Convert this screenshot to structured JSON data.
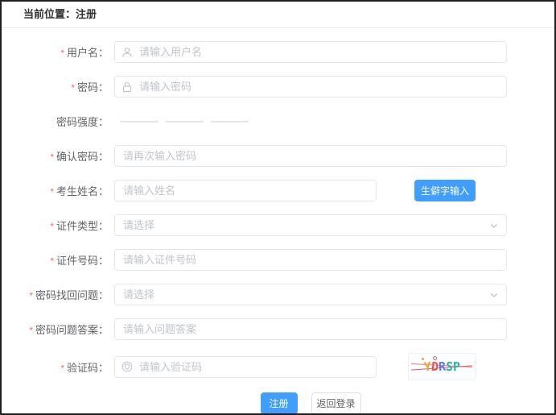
{
  "colors": {
    "primary": "#409eff",
    "required_asterisk": "#f56c6c",
    "label_text": "#606266",
    "placeholder_text": "#c0c4cc",
    "input_border": "#e4e7ed",
    "strength_bar": "#e2e5f0"
  },
  "required_mark": "*",
  "header": {
    "breadcrumb": "当前位置：注册"
  },
  "form": {
    "username": {
      "label": "用户名：",
      "placeholder": "请输入用户名"
    },
    "password": {
      "label": "密码：",
      "placeholder": "请输入密码"
    },
    "strength": {
      "label": "密码强度：",
      "bars": 3
    },
    "confirm_password": {
      "label": "确认密码：",
      "placeholder": "请再次输入密码"
    },
    "candidate_name": {
      "label": "考生姓名：",
      "placeholder": "请输入姓名",
      "rare_char_button": "生僻字输入"
    },
    "id_type": {
      "label": "证件类型：",
      "placeholder": "请选择"
    },
    "id_number": {
      "label": "证件号码：",
      "placeholder": "请输入证件号码"
    },
    "recovery_question": {
      "label": "密码找回问题：",
      "placeholder": "请选择"
    },
    "question_answer": {
      "label": "密码问题答案：",
      "placeholder": "请输入问题答案"
    },
    "captcha": {
      "label": "验证码：",
      "placeholder": "请输入验证码"
    }
  },
  "captcha_image": {
    "text": "YDRSP",
    "letters": [
      {
        "char": "Y",
        "color": "#f0a030",
        "rotate": -6
      },
      {
        "char": "D",
        "color": "#e05757",
        "rotate": 5
      },
      {
        "char": "R",
        "color": "#5b7be0",
        "rotate": -4
      },
      {
        "char": "S",
        "color": "#28b3a6",
        "rotate": 6
      },
      {
        "char": "P",
        "color": "#28b3a6",
        "rotate": -3
      }
    ]
  },
  "actions": {
    "register": "注册",
    "back_to_login": "返回登录"
  }
}
